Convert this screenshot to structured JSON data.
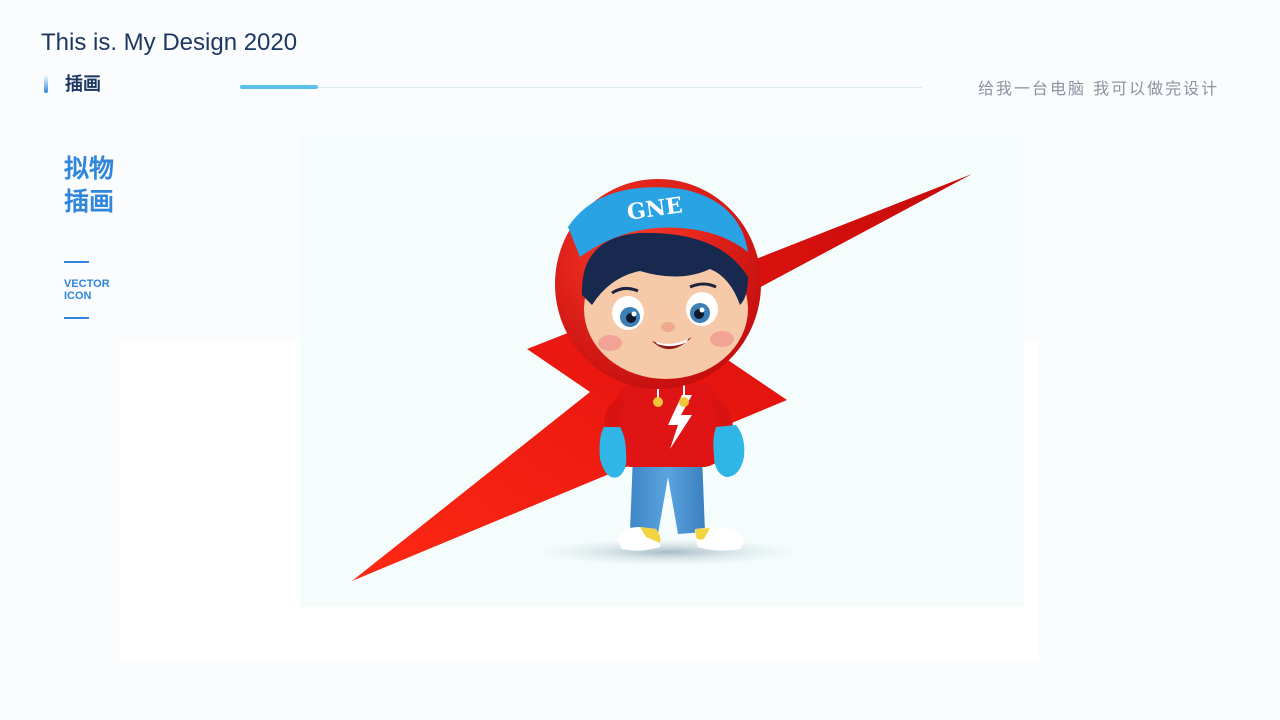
{
  "header": {
    "title": "This is. My Design 2020",
    "section": "插画",
    "slogan": "给我一台电脑  我可以做完设计"
  },
  "category": {
    "title_line1": "拟物",
    "title_line2": "插画",
    "subtitle_line1": "VECTOR",
    "subtitle_line2": "ICON"
  },
  "illustration": {
    "cap_text": "GNE",
    "colors": {
      "bolt": "#e5140f",
      "hoodie": "#e01414",
      "cap": "#2aa3e5",
      "gloves": "#2fb6e6",
      "jeans": "#4a95d2",
      "skin": "#f6c9a8",
      "shoes": "#f2d341"
    }
  }
}
